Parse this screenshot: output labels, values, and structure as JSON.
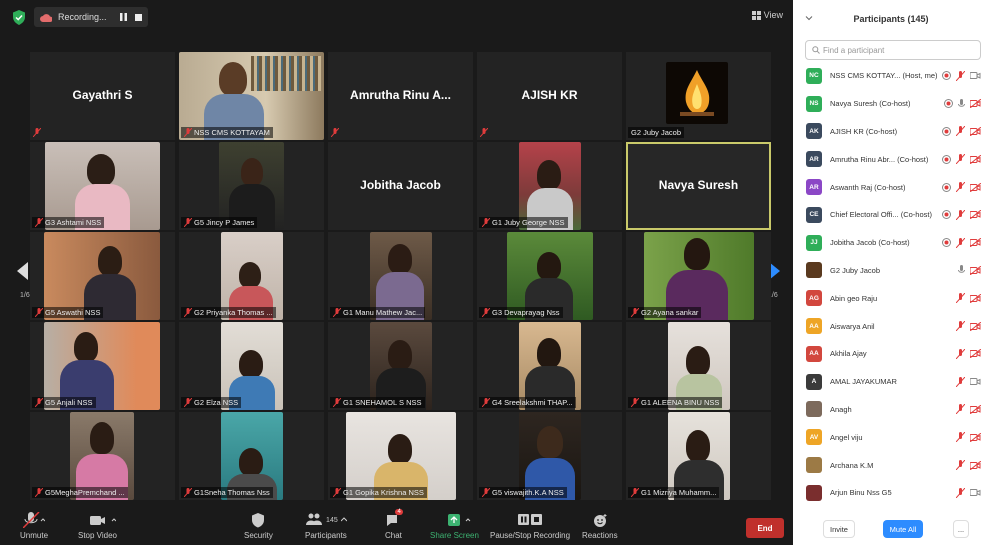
{
  "topbar": {
    "recording_label": "Recording...",
    "view_label": "View"
  },
  "grid": {
    "page_left": "1/6",
    "page_right": "1/6",
    "tiles": [
      {
        "big": "Gayathri S",
        "label": ""
      },
      {
        "big": "",
        "label": "NSS CMS KOTTAYAM"
      },
      {
        "big": "Amrutha Rinu A...",
        "label": ""
      },
      {
        "big": "AJISH KR",
        "label": ""
      },
      {
        "big": "",
        "label": "G2 Juby Jacob"
      },
      {
        "big": "",
        "label": "G3 Ashtami NSS"
      },
      {
        "big": "",
        "label": "G5 Jincy P James"
      },
      {
        "big": "Jobitha Jacob",
        "label": ""
      },
      {
        "big": "",
        "label": "G1 Juby George NSS"
      },
      {
        "big": "Navya Suresh",
        "label": ""
      },
      {
        "big": "",
        "label": "G5 Aswathi NSS"
      },
      {
        "big": "",
        "label": "G2 Priyanka Thomas ..."
      },
      {
        "big": "",
        "label": "G1 Manu Mathew Jac..."
      },
      {
        "big": "",
        "label": "G3 Devaprayag Nss"
      },
      {
        "big": "",
        "label": "G2 Ayana sankar"
      },
      {
        "big": "",
        "label": "G5 Anjali NSS"
      },
      {
        "big": "",
        "label": "G2 Elza NSS"
      },
      {
        "big": "",
        "label": "G1 SNEHAMOL S NSS"
      },
      {
        "big": "",
        "label": "G4 Sreelakshmi THAP..."
      },
      {
        "big": "",
        "label": "G1 ALEENA BINU NSS"
      },
      {
        "big": "",
        "label": "G5MeghaPremchand ..."
      },
      {
        "big": "",
        "label": "G1Sneha Thomas Nss"
      },
      {
        "big": "",
        "label": "G1 Gopika Krishna NSS"
      },
      {
        "big": "",
        "label": "G5 viswajith.K.A NSS"
      },
      {
        "big": "",
        "label": "G1 Mizriya Muhamm..."
      }
    ]
  },
  "bottombar": {
    "unmute": "Unmute",
    "stop_video": "Stop Video",
    "security": "Security",
    "participants_count": "145",
    "participants": "Participants",
    "chat": "Chat",
    "chat_badge": "4",
    "share_screen": "Share Screen",
    "pause_recording": "Pause/Stop Recording",
    "reactions": "Reactions",
    "end": "End"
  },
  "panel": {
    "title": "Participants (145)",
    "search_placeholder": "Find a participant",
    "invite": "Invite",
    "mute_all": "Mute All",
    "more": "...",
    "participants": [
      {
        "initials": "NC",
        "color": "#2fae59",
        "name": "NSS CMS KOTTAY... (Host, me)"
      },
      {
        "initials": "NS",
        "color": "#2fae59",
        "name": "Navya Suresh (Co-host)"
      },
      {
        "initials": "AK",
        "color": "#3b4a5e",
        "name": "AJISH KR (Co-host)"
      },
      {
        "initials": "AR",
        "color": "#3b4a5e",
        "name": "Amrutha Rinu Abr... (Co-host)"
      },
      {
        "initials": "AR",
        "color": "#8b47c6",
        "name": "Aswanth Raj (Co-host)"
      },
      {
        "initials": "CE",
        "color": "#3b4a5e",
        "name": "Chief Electoral Offi... (Co-host)"
      },
      {
        "initials": "JJ",
        "color": "#2fae59",
        "name": "Jobitha Jacob (Co-host)"
      },
      {
        "initials": "",
        "color": "#5a3a1f",
        "name": "G2 Juby Jacob"
      },
      {
        "initials": "AG",
        "color": "#d2473e",
        "name": "Abin geo Raju"
      },
      {
        "initials": "AA",
        "color": "#eea526",
        "name": "Aiswarya Anil"
      },
      {
        "initials": "AA",
        "color": "#d2473e",
        "name": "Akhila Ajay"
      },
      {
        "initials": "A",
        "color": "#3b3b3b",
        "name": "AMAL JAYAKUMAR"
      },
      {
        "initials": "",
        "color": "#7d6a5c",
        "name": "Anagh"
      },
      {
        "initials": "AV",
        "color": "#eea526",
        "name": "Angel viju"
      },
      {
        "initials": "",
        "color": "#9c7a45",
        "name": "Archana K.M"
      },
      {
        "initials": "",
        "color": "#7a2e2e",
        "name": "Arjun Binu Nss G5"
      }
    ]
  }
}
